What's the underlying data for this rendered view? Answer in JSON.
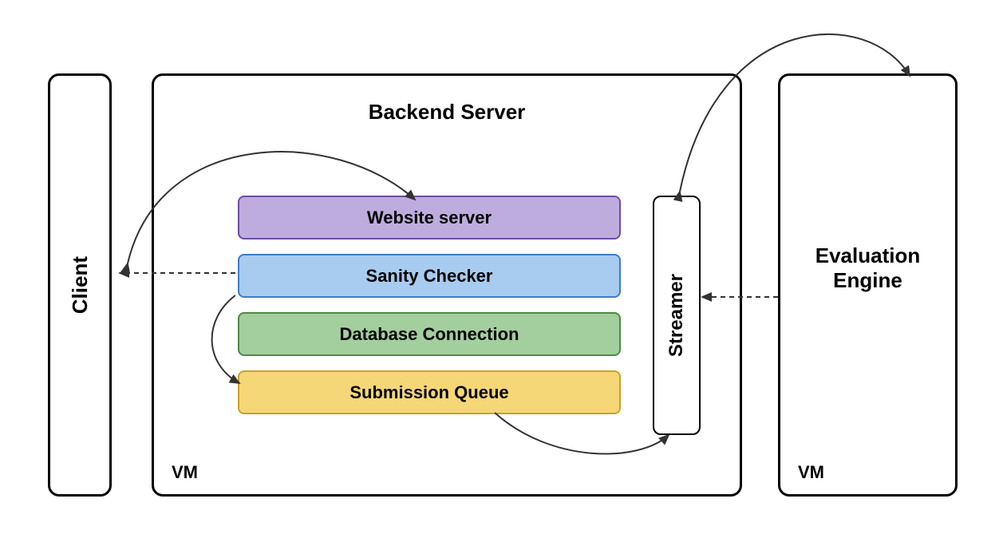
{
  "client": {
    "label": "Client"
  },
  "backend": {
    "title": "Backend Server",
    "vm_label": "VM",
    "components": {
      "website_server": "Website server",
      "sanity_checker": "Sanity Checker",
      "database_connection": "Database Connection",
      "submission_queue": "Submission Queue"
    },
    "streamer": "Streamer"
  },
  "evaluation": {
    "title_line1": "Evaluation",
    "title_line2": "Engine",
    "vm_label": "VM"
  },
  "arrows": [
    {
      "name": "client-to-website-server",
      "style": "solid-curve"
    },
    {
      "name": "sanity-checker-to-client",
      "style": "dashed"
    },
    {
      "name": "sanity-checker-to-submission-queue",
      "style": "solid-curve"
    },
    {
      "name": "submission-queue-to-streamer",
      "style": "solid-curve"
    },
    {
      "name": "streamer-to-evaluation-engine",
      "style": "solid-curve"
    },
    {
      "name": "evaluation-engine-to-streamer",
      "style": "dashed"
    }
  ]
}
